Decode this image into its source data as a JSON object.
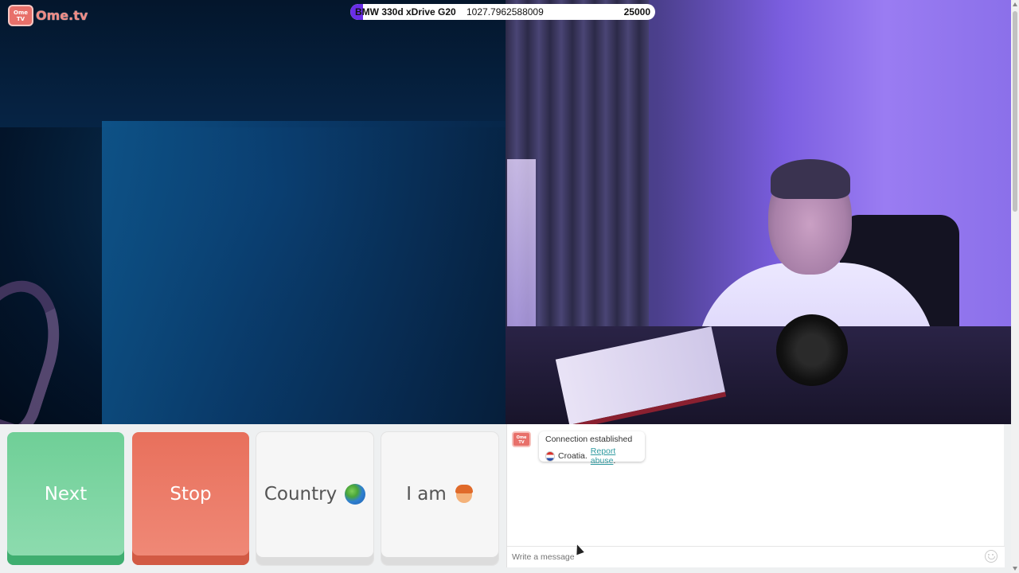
{
  "app": {
    "logo_text": "Ome.tv",
    "logo_badge": "Ome TV"
  },
  "progress": {
    "car": "BMW 330d xDrive G20",
    "value": "1027.7962588009",
    "target": "25000",
    "fraction": 0.041,
    "fill_color": "#6a2ee8"
  },
  "controls": {
    "next_label": "Next",
    "stop_label": "Stop",
    "country_label": "Country",
    "iam_label": "I am",
    "next_color": "#6fcf97",
    "stop_color": "#e8705c"
  },
  "chat": {
    "avatar_text": "Ome TV",
    "status": "Connection established",
    "country": "Croatia.",
    "report_link": "Report abuse",
    "report_suffix": ".",
    "input_placeholder": "Write a message"
  },
  "icons": {
    "globe": "globe-icon",
    "person": "person-icon",
    "flag": "croatia-flag-icon",
    "emoji": "emoji-icon"
  }
}
